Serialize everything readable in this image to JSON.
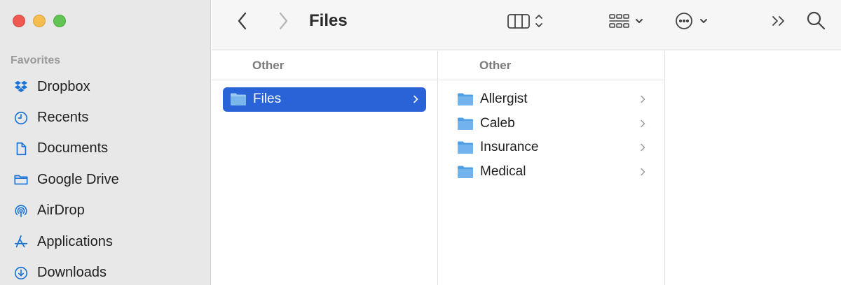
{
  "sidebar": {
    "heading": "Favorites",
    "items": [
      {
        "label": "Dropbox",
        "icon": "dropbox-icon"
      },
      {
        "label": "Recents",
        "icon": "clock-icon"
      },
      {
        "label": "Documents",
        "icon": "document-icon"
      },
      {
        "label": "Google Drive",
        "icon": "folder-icon"
      },
      {
        "label": "AirDrop",
        "icon": "airdrop-icon"
      },
      {
        "label": "Applications",
        "icon": "applications-icon"
      },
      {
        "label": "Downloads",
        "icon": "download-icon"
      }
    ]
  },
  "toolbar": {
    "title": "Files",
    "icons": [
      "chevron-left-icon",
      "chevron-right-icon",
      "column-view-icon",
      "group-icon",
      "action-ellipsis-icon",
      "overflow-icon",
      "search-icon"
    ]
  },
  "columns": [
    {
      "header": "Other",
      "items": [
        {
          "label": "Files",
          "selected": true
        }
      ]
    },
    {
      "header": "Other",
      "items": [
        {
          "label": "Allergist"
        },
        {
          "label": "Caleb"
        },
        {
          "label": "Insurance"
        },
        {
          "label": "Medical"
        }
      ]
    }
  ],
  "colors": {
    "selection": "#2a63d8",
    "icon_accent": "#1a73d6",
    "sidebar_bg": "#e8e8e8"
  }
}
